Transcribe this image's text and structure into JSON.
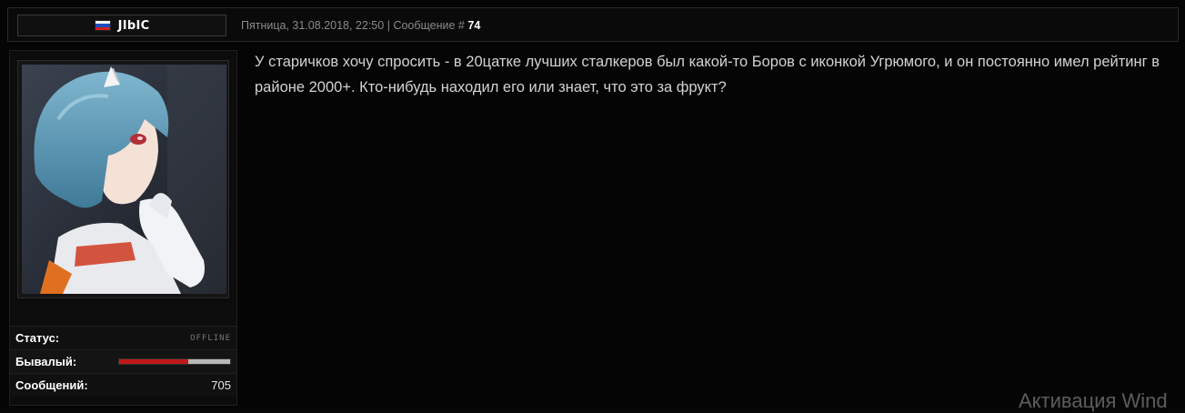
{
  "header": {
    "username": "JIbIC",
    "datetime": "Пятница, 31.08.2018, 22:50",
    "separator": "|",
    "message_label": "Сообщение #",
    "message_number": "74"
  },
  "sidebar": {
    "status_label": "Статус:",
    "status_value": "OFFLINE",
    "rank_label": "Бывалый:",
    "rank_progress": 0.62,
    "messages_label": "Сообщений:",
    "messages_value": "705"
  },
  "post": {
    "text": "У старичков хочу спросить - в 20цатке лучших сталкеров был какой-то Боров с иконкой Угрюмого, и он постоянно имел рейтинг в районе 2000+. Кто-нибудь находил его или знает, что это за фрукт?"
  },
  "watermark": "Активация Wind",
  "colors": {
    "rank_fill": "#c01818",
    "rank_track": "#b9b9b9",
    "flag": [
      "#f4f4f4",
      "#1a4fc2",
      "#d42020"
    ]
  },
  "icons": [
    "russia-flag-icon",
    "user-avatar-image"
  ]
}
